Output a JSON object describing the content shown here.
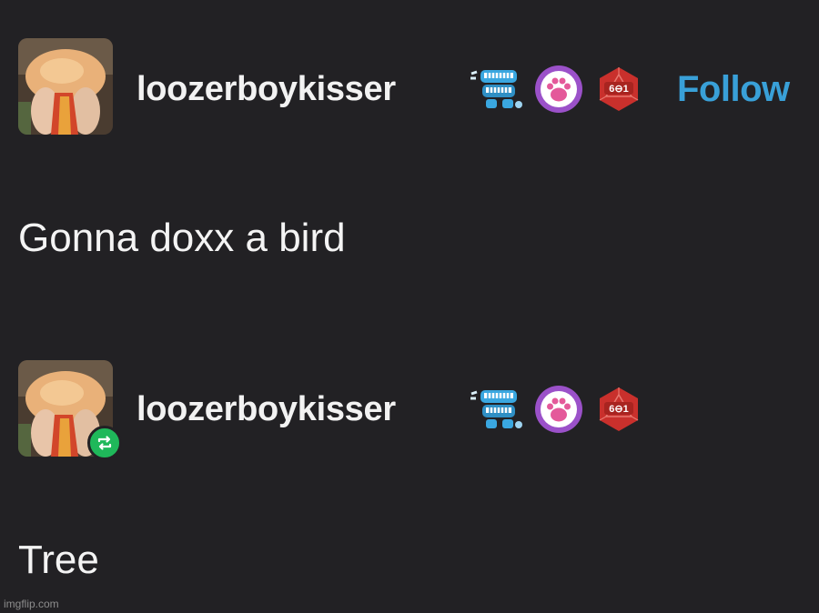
{
  "posts": [
    {
      "username": "loozerboykisser",
      "follow_label": "Follow",
      "text": "Gonna doxx a bird"
    },
    {
      "username": "loozerboykisser",
      "text": "Tree"
    }
  ],
  "badges": {
    "d20_label": "6⊖1"
  },
  "icons": {
    "badge_1": "chattering-teeth-icon",
    "badge_2": "paw-print-icon",
    "badge_3": "d20-dice-icon",
    "reblog": "reblog-icon"
  },
  "colors": {
    "background": "#222124",
    "follow": "#39a0d8",
    "reblog_badge": "#1fb85a"
  },
  "watermark": "imgflip.com"
}
